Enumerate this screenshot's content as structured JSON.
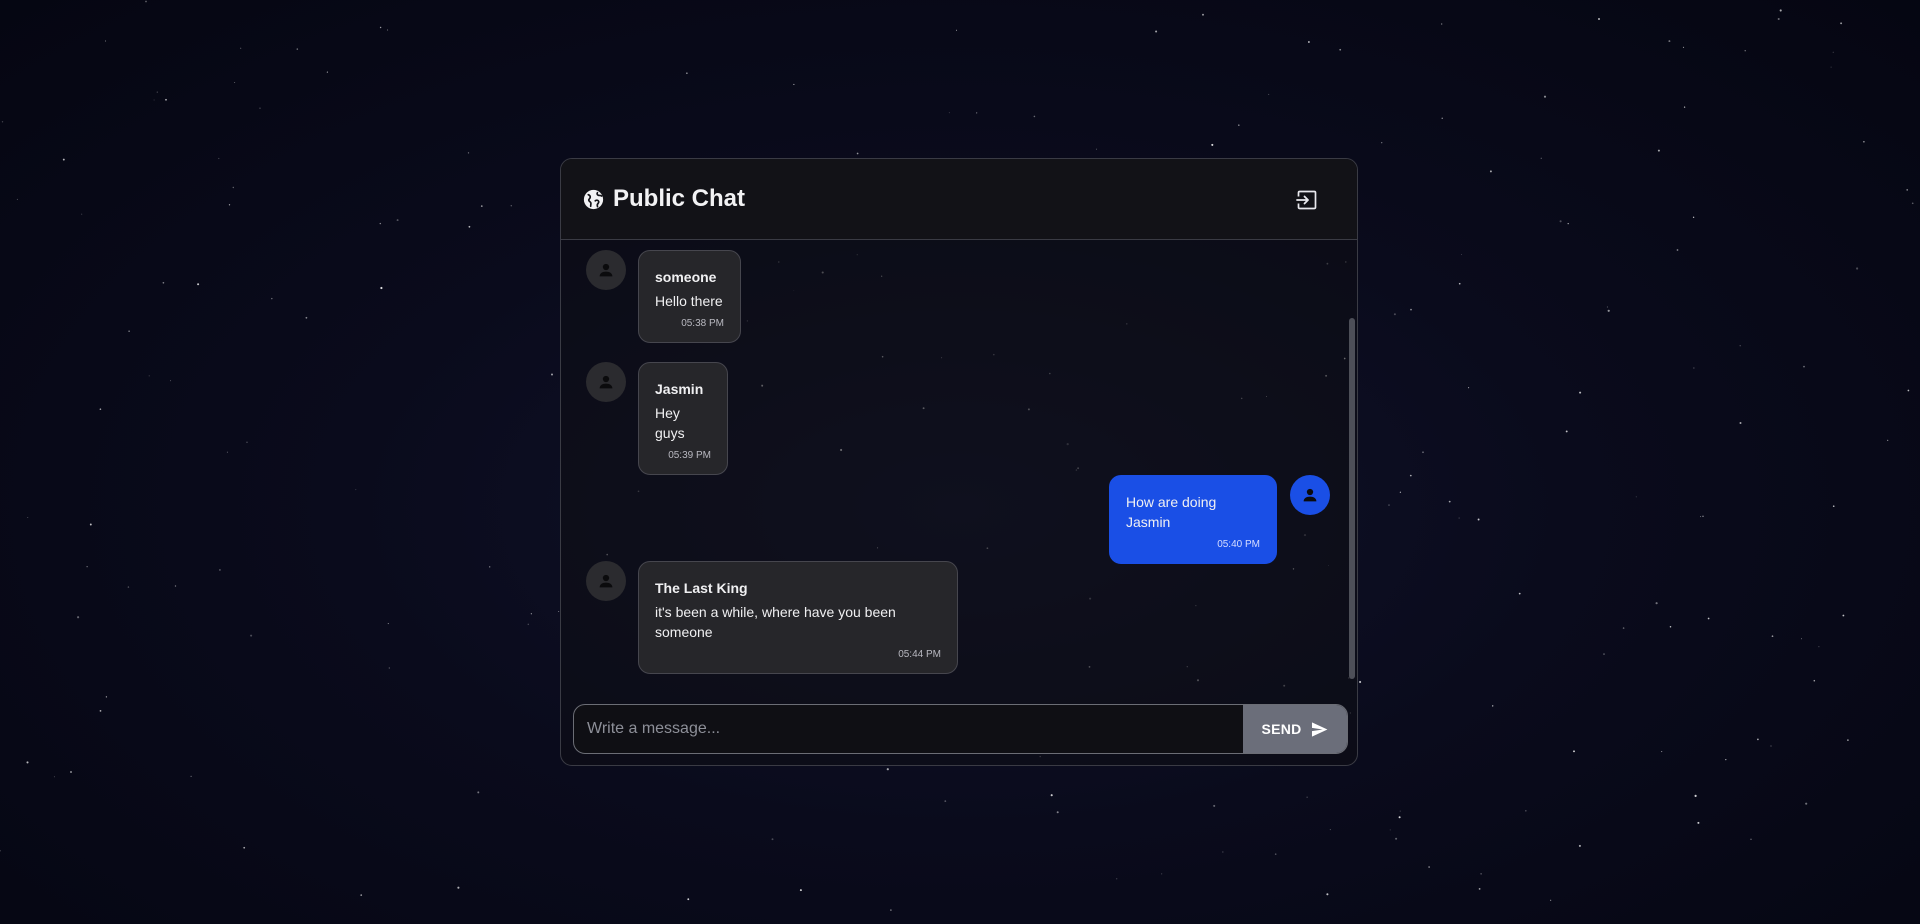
{
  "theme": {
    "accent": "#1a4fe6",
    "bubble_other": "#26262a",
    "send_button": "#6b6e7a",
    "background": "#0a0b1c"
  },
  "header": {
    "icon": "globe-icon",
    "title": "Public Chat",
    "action_icon": "logout-icon"
  },
  "messages": [
    {
      "sender": "someone",
      "text": "Hello there",
      "time": "05:38 PM",
      "own": false
    },
    {
      "sender": "Jasmin",
      "text": "Hey guys",
      "time": "05:39 PM",
      "own": false
    },
    {
      "sender": "",
      "text": "How are doing Jasmin",
      "time": "05:40 PM",
      "own": true
    },
    {
      "sender": "The Last King",
      "text": "it's been a while, where have you been someone",
      "time": "05:44 PM",
      "own": false
    }
  ],
  "composer": {
    "placeholder": "Write a message...",
    "value": "",
    "send_label": "SEND",
    "send_icon": "send-icon"
  }
}
